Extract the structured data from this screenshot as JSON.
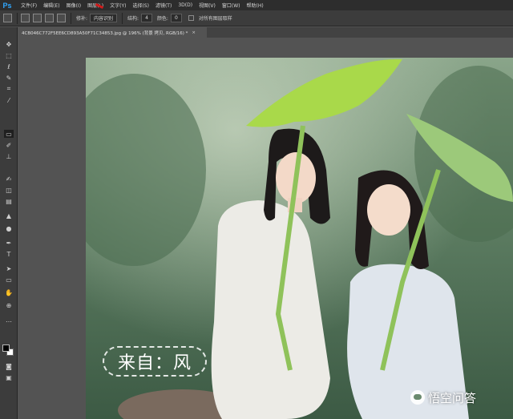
{
  "app": {
    "logo": "Ps"
  },
  "menu": {
    "items": [
      "文件(F)",
      "编辑(E)",
      "图像(I)",
      "图层(L)",
      "文字(Y)",
      "选择(S)",
      "滤镜(T)",
      "3D(D)",
      "视图(V)",
      "窗口(W)",
      "帮助(H)"
    ]
  },
  "options": {
    "patch_label": "修补:",
    "patch_value": "内容识别",
    "structure_label": "结构:",
    "structure_value": "4",
    "color_label": "颜色:",
    "color_value": "0",
    "sample_all_label": "对所有图层取样"
  },
  "document": {
    "tab_title": "4CB046C772F5EE6CD893A50F71C34853.jpg @ 196% (背景 拷贝, RGB/16) *",
    "close_glyph": "×"
  },
  "overlay": {
    "credit_text": "来自：风",
    "watermark_text": "悟空问答"
  },
  "colors": {
    "foreground": "#000000",
    "background": "#ffffff",
    "ps_blue": "#31a8ff",
    "annotation_arrow": "#d21b1b"
  },
  "tools": [
    "move-icon",
    "marquee-icon",
    "lasso-icon",
    "quick-select-icon",
    "crop-icon",
    "eyedropper-icon",
    "healing-brush-icon",
    "brush-icon",
    "clone-stamp-icon",
    "history-brush-icon",
    "eraser-icon",
    "gradient-icon",
    "blur-icon",
    "dodge-icon",
    "pen-icon",
    "type-icon",
    "path-select-icon",
    "shape-icon",
    "hand-icon",
    "zoom-icon"
  ]
}
